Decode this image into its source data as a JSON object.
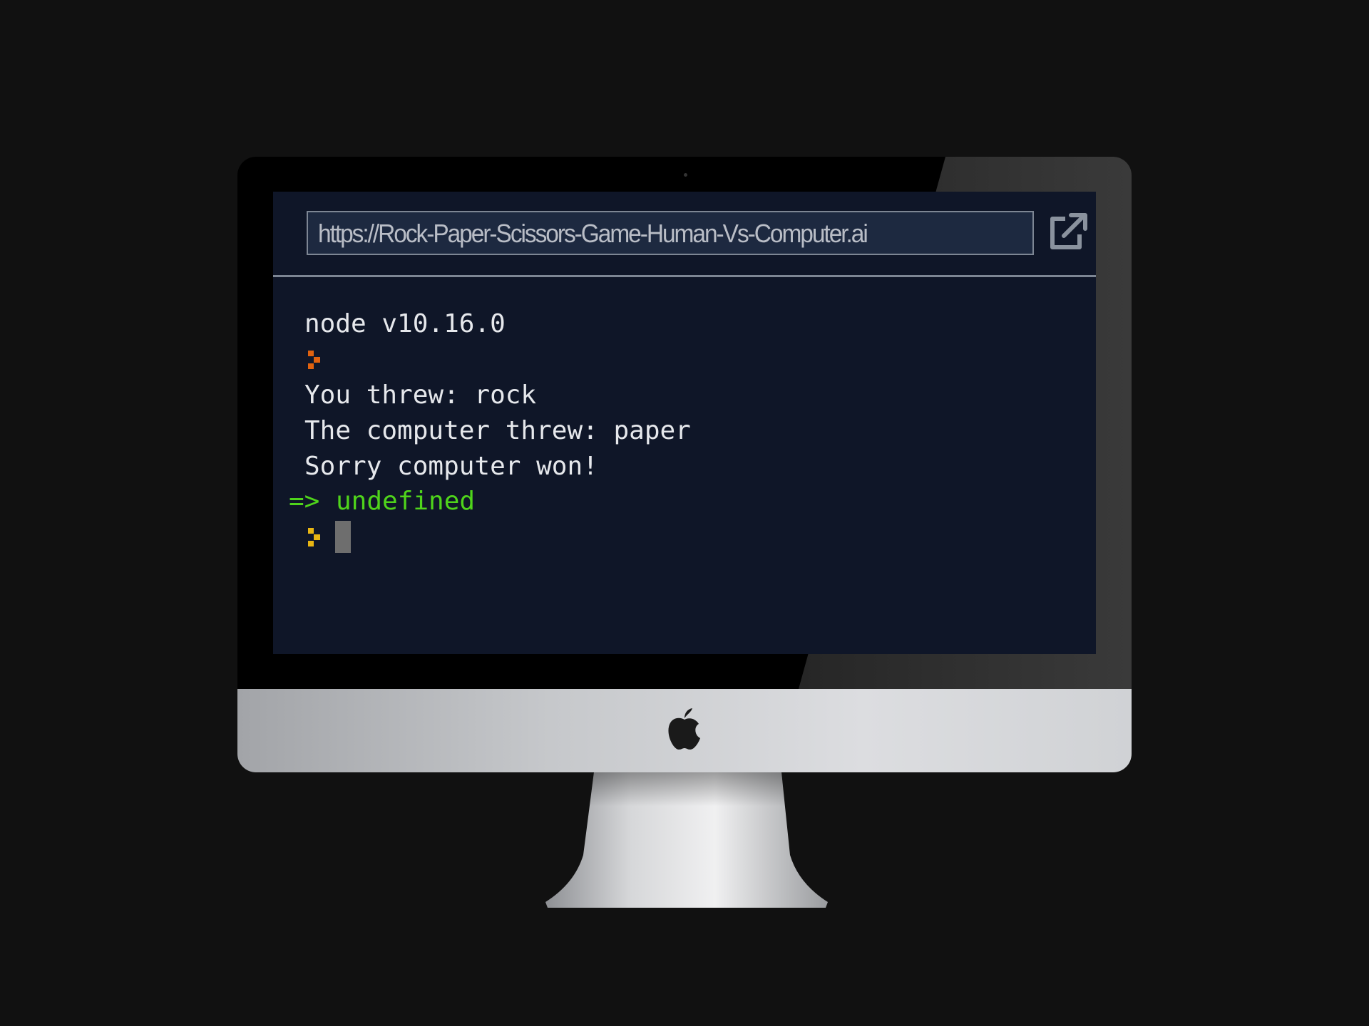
{
  "browser": {
    "url": "https://Rock-Paper-Scissors-Game-Human-Vs-Computer.ai",
    "open_in_new_tab_icon": "external-link-icon"
  },
  "console": {
    "version_line": "node v10.16.0",
    "output_lines": [
      "You threw: rock",
      "The computer threw: paper",
      "Sorry computer won!"
    ],
    "result_arrow": "=>",
    "result_value": "undefined"
  },
  "colors": {
    "console_bg": "#0f1628",
    "result_green": "#4fd41b",
    "prompt_orange": "#e0620f",
    "prompt_yellow": "#e8b513"
  }
}
